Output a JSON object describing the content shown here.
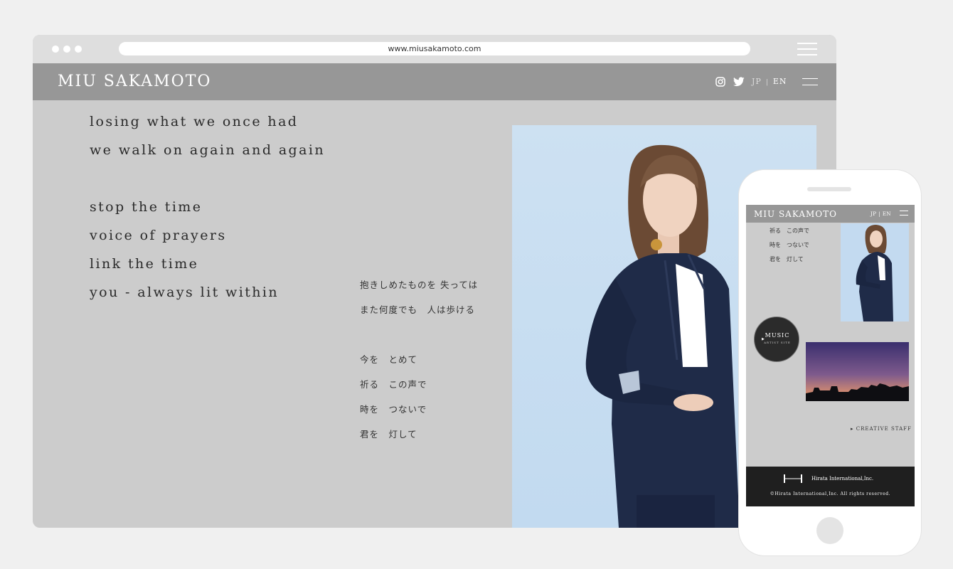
{
  "browser": {
    "url": "www.miusakamoto.com"
  },
  "site": {
    "logo": "MIU SAKAMOTO",
    "lang_jp": "JP",
    "lang_sep": "|",
    "lang_en": "EN",
    "icons": [
      "instagram-icon",
      "twitter-icon",
      "hamburger-menu-icon"
    ]
  },
  "lyrics_en": {
    "verse1": [
      "losing what we once had",
      "we walk on again and again"
    ],
    "verse2": [
      "stop the time",
      "voice of prayers",
      "link the time",
      "you - always lit within"
    ]
  },
  "lyrics_ja": {
    "verse1": [
      "抱きしめたものを 失っては",
      "また何度でも　人は歩ける"
    ],
    "verse2": [
      "今を　とめて",
      "祈る　この声で",
      "時を　つないで",
      "君を　灯して"
    ]
  },
  "mobile": {
    "logo": "MIU SAKAMOTO",
    "lang": "JP | EN",
    "lyrics": [
      "祈る　この声で",
      "時を　つないで",
      "君を　灯して"
    ],
    "music_title": "MUSIC",
    "music_sub": "ARTIST SITE",
    "creative_staff": "CREATIVE STAFF",
    "footer_company": "Hirata International,Inc.",
    "footer_copyright": "©Hirata International,Inc. All rights reserved."
  },
  "colors": {
    "page_bg": "#f0f0f0",
    "content_bg": "#cccccc",
    "header_bg": "#979797",
    "photo_bg": "#c6ddf1",
    "footer_bg": "#1f1f1f"
  }
}
